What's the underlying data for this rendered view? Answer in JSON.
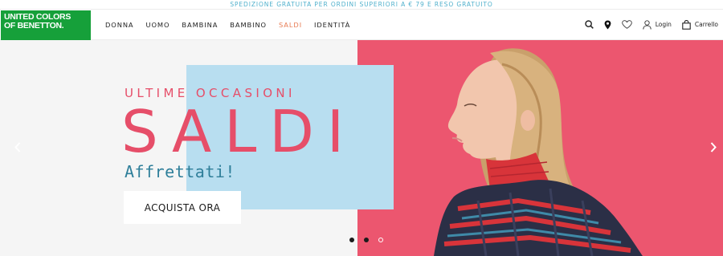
{
  "promo_bar": {
    "text": "SPEDIZIONE GRATUITA PER ORDINI SUPERIORI A € 79 E RESO GRATUITO"
  },
  "header": {
    "logo_line1": "UNITED COLORS",
    "logo_line2": "OF BENETTON.",
    "nav": [
      {
        "label": "DONNA"
      },
      {
        "label": "UOMO"
      },
      {
        "label": "BAMBINA"
      },
      {
        "label": "BAMBINO"
      },
      {
        "label": "SALDI"
      },
      {
        "label": "IDENTITÀ"
      }
    ],
    "login_label": "Login",
    "cart_label": "Carrello"
  },
  "hero": {
    "subtitle": "ULTIME OCCASIONI",
    "title": "SALDI",
    "tagline": "Affrettati!",
    "cta_label": "ACQUISTA ORA",
    "active_slide": 2
  },
  "colors": {
    "logo_green": "#16a03a",
    "promo_blue": "#4fb0cc",
    "sale_orange": "#e87c54",
    "hero_pink": "#ec566f",
    "title_pink": "#e64e69",
    "square_blue": "#b8def0",
    "tagline_teal": "#2f7f9a"
  },
  "icons": [
    "search-icon",
    "location-pin-icon",
    "heart-icon",
    "user-icon",
    "bag-icon",
    "chevron-left-icon",
    "chevron-right-icon"
  ]
}
